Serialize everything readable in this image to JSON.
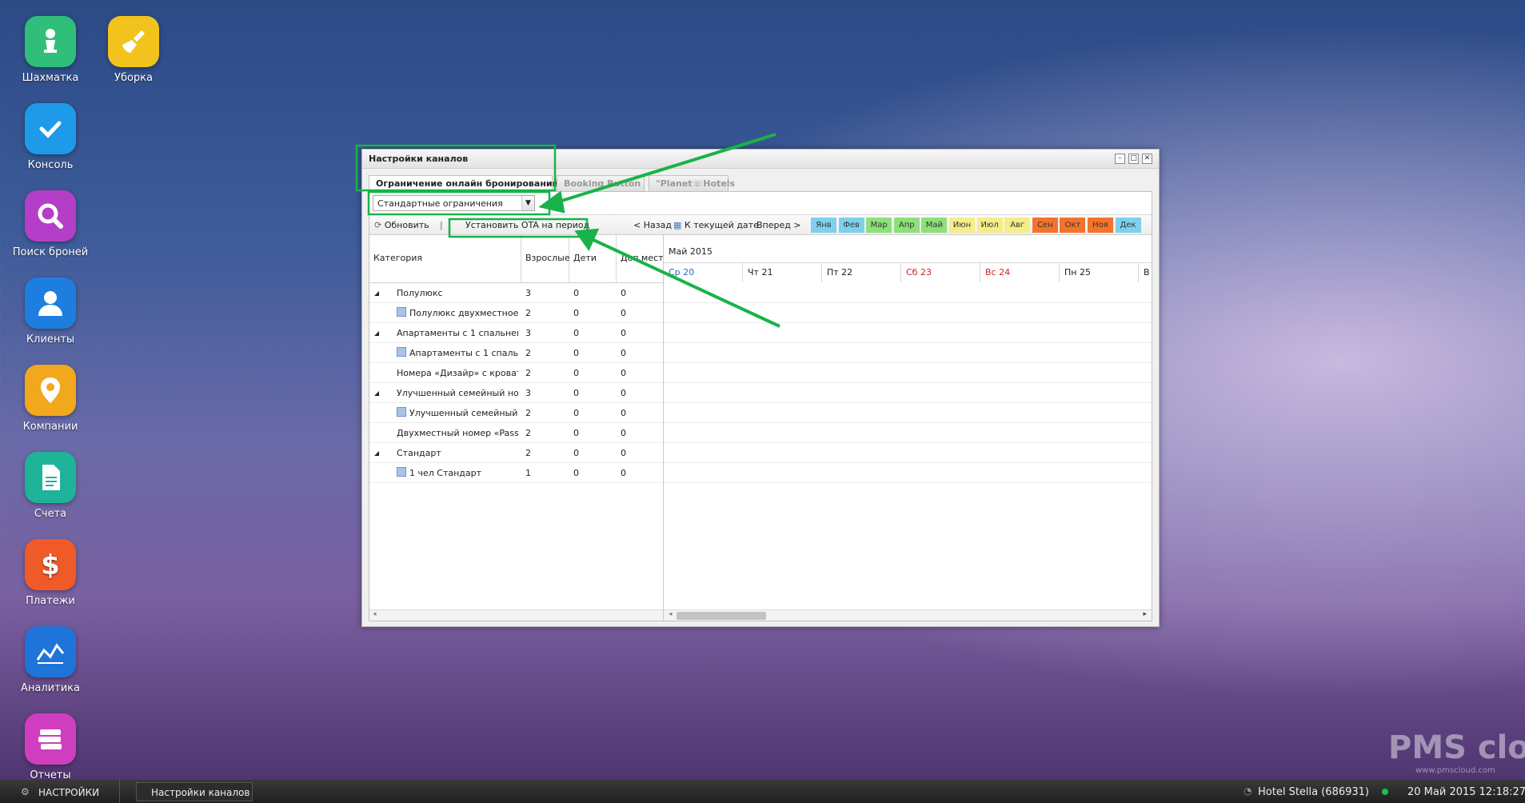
{
  "desktop": {
    "icons": [
      {
        "label": "Шахматка",
        "icon": "chess-pawn-icon",
        "color": "#2fbf7a"
      },
      {
        "label": "Уборка",
        "icon": "broom-icon",
        "color": "#f2c31c"
      },
      {
        "label": "Консоль",
        "icon": "checkmark-icon",
        "color": "#1e9be8"
      },
      {
        "label": "Поиск броней",
        "icon": "magnifier-icon",
        "color": "#b43ec8"
      },
      {
        "label": "Клиенты",
        "icon": "person-icon",
        "color": "#1e7ee0"
      },
      {
        "label": "Компании",
        "icon": "map-pin-icon",
        "color": "#f2a81c"
      },
      {
        "label": "Счета",
        "icon": "document-icon",
        "color": "#1fb39a"
      },
      {
        "label": "Платежи",
        "icon": "dollar-icon",
        "color": "#f05a28"
      },
      {
        "label": "Аналитика",
        "icon": "chart-icon",
        "color": "#1e74d8"
      },
      {
        "label": "Отчеты",
        "icon": "books-icon",
        "color": "#d03ec0"
      }
    ]
  },
  "window": {
    "title": "Настройки каналов",
    "controls": [
      "–",
      "□",
      "✕"
    ],
    "tabs": [
      {
        "label": "Ограничение онлайн бронирований",
        "active": true
      },
      {
        "label": "Booking Button",
        "active": false
      },
      {
        "label": "\"Planet☏Hotels",
        "active": false
      }
    ],
    "restriction_select": {
      "value": "Стандартные ограничения"
    },
    "toolbar": {
      "refresh": "Обновить",
      "separator": "|",
      "set_ota": "Установить OTA на период",
      "back": "< Назад",
      "today": "К текущей дате",
      "forward": "Вперед >",
      "months": [
        {
          "label": "Янв",
          "color": "#7fd0ef"
        },
        {
          "label": "Фев",
          "color": "#7fd0ef"
        },
        {
          "label": "Мар",
          "color": "#8de07a"
        },
        {
          "label": "Апр",
          "color": "#8de07a"
        },
        {
          "label": "Май",
          "color": "#8de07a"
        },
        {
          "label": "Июн",
          "color": "#f4ee8a"
        },
        {
          "label": "Июл",
          "color": "#f4ee8a"
        },
        {
          "label": "Авг",
          "color": "#f4ee8a"
        },
        {
          "label": "Сен",
          "color": "#f4732c"
        },
        {
          "label": "Окт",
          "color": "#f4732c"
        },
        {
          "label": "Ноя",
          "color": "#f4732c"
        },
        {
          "label": "Дек",
          "color": "#7fd0ef"
        }
      ]
    },
    "grid": {
      "columns": [
        "Категория",
        "Взрослые",
        "Дети",
        "Доп.мест"
      ],
      "month_label": "Май 2015",
      "days": [
        {
          "label": "Ср 20",
          "color": "#1a6fc4"
        },
        {
          "label": "Чт 21",
          "color": "#222222"
        },
        {
          "label": "Пт 22",
          "color": "#222222"
        },
        {
          "label": "Сб 23",
          "color": "#d62020"
        },
        {
          "label": "Вс 24",
          "color": "#d62020"
        },
        {
          "label": "Пн 25",
          "color": "#222222"
        },
        {
          "label": "В",
          "color": "#222222"
        }
      ],
      "rows": [
        {
          "category": "Полулюкс",
          "adults": "3",
          "children": "0",
          "extra": "0",
          "level": 0,
          "expander": true
        },
        {
          "category": "Полулюкс двухместное",
          "adults": "2",
          "children": "0",
          "extra": "0",
          "level": 1,
          "expander": false
        },
        {
          "category": "Апартаменты с 1 спальней ...",
          "adults": "3",
          "children": "0",
          "extra": "0",
          "level": 0,
          "expander": true
        },
        {
          "category": "Апартаменты с 1 спальн...",
          "adults": "2",
          "children": "0",
          "extra": "0",
          "level": 1,
          "expander": false
        },
        {
          "category": "Номера «Дизайр» с кроват...",
          "adults": "2",
          "children": "0",
          "extra": "0",
          "level": 2,
          "expander": false
        },
        {
          "category": "Улучшенный семейный ном...",
          "adults": "3",
          "children": "0",
          "extra": "0",
          "level": 0,
          "expander": true
        },
        {
          "category": "Улучшенный семейный ...",
          "adults": "2",
          "children": "0",
          "extra": "0",
          "level": 1,
          "expander": false
        },
        {
          "category": "Двухместный номер «Passi...",
          "adults": "2",
          "children": "0",
          "extra": "0",
          "level": 2,
          "expander": false
        },
        {
          "category": "Стандарт",
          "adults": "2",
          "children": "0",
          "extra": "0",
          "level": 0,
          "expander": true
        },
        {
          "category": "1 чел Стандарт",
          "adults": "1",
          "children": "0",
          "extra": "0",
          "level": 1,
          "expander": false
        }
      ]
    }
  },
  "taskbar": {
    "start": "НАСТРОЙКИ",
    "window_button": "Настройки каналов",
    "hotel": "Hotel Stella (686931)",
    "datetime": "20 Май 2015 12:18:27"
  },
  "watermark": {
    "text": "PMS cloud",
    "url": "www.pmscloud.com"
  },
  "accent": {
    "highlight": "#19b24a"
  }
}
